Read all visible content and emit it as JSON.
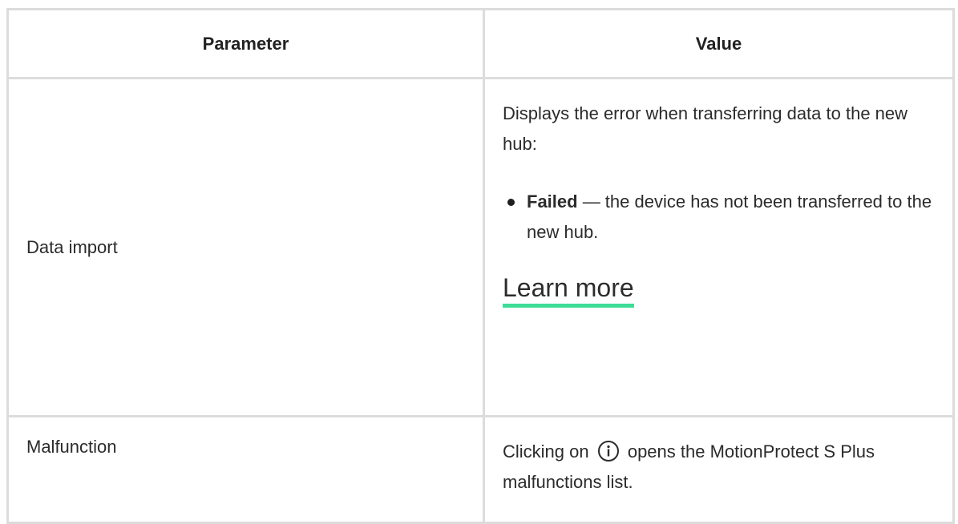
{
  "table": {
    "headers": {
      "parameter": "Parameter",
      "value": "Value"
    },
    "rows": [
      {
        "parameter": "Data import",
        "value_intro": "Displays the error when transferring data to the new hub:",
        "bullets": [
          {
            "strong": "Failed",
            "text": " — the device has not been transferred to the new hub."
          }
        ],
        "link_label": "Learn more",
        "link_underline_color": "#3ddc97"
      },
      {
        "parameter": "Malfunction",
        "value_before_icon": "Clicking on ",
        "icon": "info-icon",
        "value_after_icon": " opens the MotionProtect S Plus malfunctions list."
      }
    ]
  }
}
